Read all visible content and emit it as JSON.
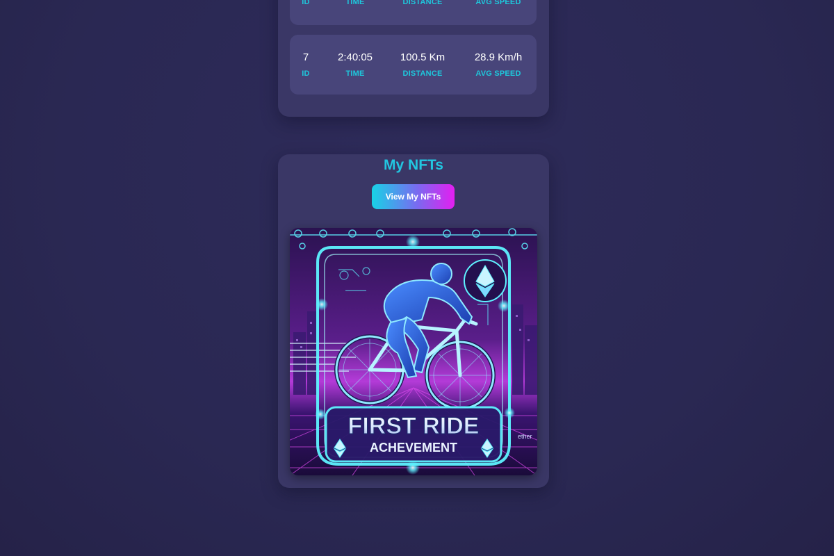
{
  "rides": {
    "rows": [
      {
        "id": "",
        "time": "",
        "distance": "",
        "avg_speed": "",
        "labels": {
          "id": "ID",
          "time": "TIME",
          "distance": "DISTANCE",
          "avg_speed": "AVG SPEED"
        }
      },
      {
        "id": "7",
        "time": "2:40:05",
        "distance": "100.5 Km",
        "avg_speed": "28.9 Km/h",
        "labels": {
          "id": "ID",
          "time": "TIME",
          "distance": "DISTANCE",
          "avg_speed": "AVG SPEED"
        }
      }
    ]
  },
  "nfts": {
    "title": "My NFTs",
    "view_button_label": "View My NFTs",
    "items": [
      {
        "title_line1": "FIRST RIDE",
        "title_line2": "ACHEVEMENT",
        "corner_text": "ether"
      }
    ]
  },
  "colors": {
    "background": "#2a2853",
    "card": "#3a3766",
    "row": "#48457a",
    "accent_cyan": "#1ec8dc",
    "accent_magenta": "#e31ff0"
  }
}
